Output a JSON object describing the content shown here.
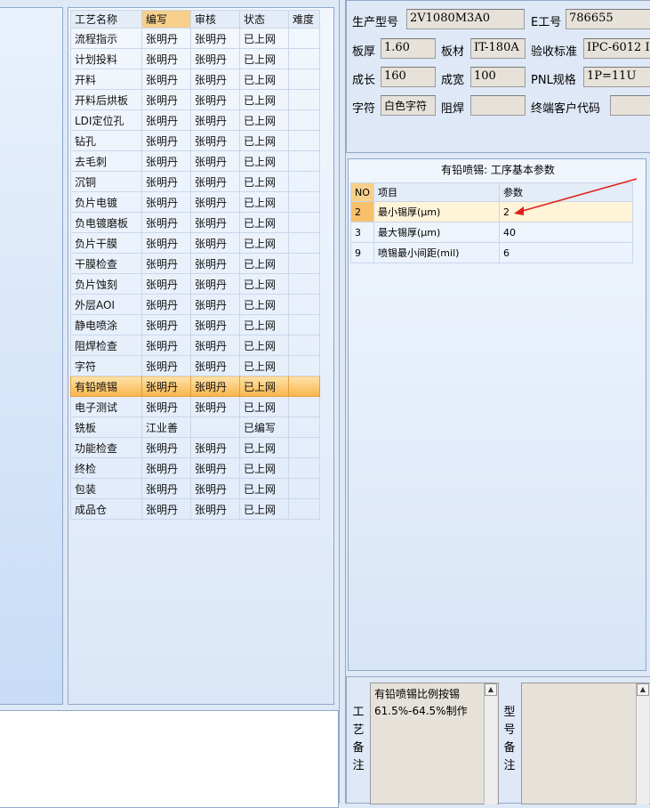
{
  "process_grid": {
    "columns": [
      "工艺名称",
      "编写",
      "审核",
      "状态",
      "难度"
    ],
    "selected_row": "有铅喷锡",
    "rows": [
      {
        "name": "流程指示",
        "author": "张明丹",
        "reviewer": "张明丹",
        "status": "已上网",
        "difficulty": ""
      },
      {
        "name": "计划投料",
        "author": "张明丹",
        "reviewer": "张明丹",
        "status": "已上网",
        "difficulty": ""
      },
      {
        "name": "开料",
        "author": "张明丹",
        "reviewer": "张明丹",
        "status": "已上网",
        "difficulty": ""
      },
      {
        "name": "开料后烘板",
        "author": "张明丹",
        "reviewer": "张明丹",
        "status": "已上网",
        "difficulty": ""
      },
      {
        "name": "LDI定位孔",
        "author": "张明丹",
        "reviewer": "张明丹",
        "status": "已上网",
        "difficulty": ""
      },
      {
        "name": "钻孔",
        "author": "张明丹",
        "reviewer": "张明丹",
        "status": "已上网",
        "difficulty": ""
      },
      {
        "name": "去毛刺",
        "author": "张明丹",
        "reviewer": "张明丹",
        "status": "已上网",
        "difficulty": ""
      },
      {
        "name": "沉铜",
        "author": "张明丹",
        "reviewer": "张明丹",
        "status": "已上网",
        "difficulty": ""
      },
      {
        "name": "负片电镀",
        "author": "张明丹",
        "reviewer": "张明丹",
        "status": "已上网",
        "difficulty": ""
      },
      {
        "name": "负电镀磨板",
        "author": "张明丹",
        "reviewer": "张明丹",
        "status": "已上网",
        "difficulty": ""
      },
      {
        "name": "负片干膜",
        "author": "张明丹",
        "reviewer": "张明丹",
        "status": "已上网",
        "difficulty": ""
      },
      {
        "name": "干膜检查",
        "author": "张明丹",
        "reviewer": "张明丹",
        "status": "已上网",
        "difficulty": ""
      },
      {
        "name": "负片蚀刻",
        "author": "张明丹",
        "reviewer": "张明丹",
        "status": "已上网",
        "difficulty": ""
      },
      {
        "name": "外层AOI",
        "author": "张明丹",
        "reviewer": "张明丹",
        "status": "已上网",
        "difficulty": ""
      },
      {
        "name": "静电喷涂",
        "author": "张明丹",
        "reviewer": "张明丹",
        "status": "已上网",
        "difficulty": ""
      },
      {
        "name": "阻焊检查",
        "author": "张明丹",
        "reviewer": "张明丹",
        "status": "已上网",
        "difficulty": ""
      },
      {
        "name": "字符",
        "author": "张明丹",
        "reviewer": "张明丹",
        "status": "已上网",
        "difficulty": ""
      },
      {
        "name": "有铅喷锡",
        "author": "张明丹",
        "reviewer": "张明丹",
        "status": "已上网",
        "difficulty": ""
      },
      {
        "name": "电子测试",
        "author": "张明丹",
        "reviewer": "张明丹",
        "status": "已上网",
        "difficulty": ""
      },
      {
        "name": "铣板",
        "author": "江业善",
        "reviewer": "",
        "status": "已编写",
        "difficulty": ""
      },
      {
        "name": "功能检查",
        "author": "张明丹",
        "reviewer": "张明丹",
        "status": "已上网",
        "difficulty": ""
      },
      {
        "name": "终检",
        "author": "张明丹",
        "reviewer": "张明丹",
        "status": "已上网",
        "difficulty": ""
      },
      {
        "name": "包装",
        "author": "张明丹",
        "reviewer": "张明丹",
        "status": "已上网",
        "difficulty": ""
      },
      {
        "name": "成品仓",
        "author": "张明丹",
        "reviewer": "张明丹",
        "status": "已上网",
        "difficulty": ""
      }
    ]
  },
  "info": {
    "model_label": "生产型号",
    "model_value": "2V1080M3A0",
    "e_no_label": "E工号",
    "e_no_value": "786655",
    "thickness_label": "板厚",
    "thickness_value": "1.60",
    "material_label": "板材",
    "material_value": "IT-180A",
    "standard_label": "验收标准",
    "standard_value": "IPC-6012 I",
    "length_label": "成长",
    "length_value": "160",
    "width_label": "成宽",
    "width_value": "100",
    "pnl_label": "PNL规格",
    "pnl_value": "1P=11U",
    "char_label": "字符",
    "char_value": "白色字符",
    "mask_label": "阻焊",
    "mask_value": "",
    "customer_label": "终端客户代码",
    "customer_value": ""
  },
  "params": {
    "title": "有铅喷锡: 工序基本参数",
    "columns": [
      "NO",
      "项目",
      "参数"
    ],
    "rows": [
      {
        "no": "2",
        "item": "最小锡厚(μm)",
        "value": "2"
      },
      {
        "no": "3",
        "item": "最大锡厚(μm)",
        "value": "40"
      },
      {
        "no": "9",
        "item": "喷锡最小间距(mil)",
        "value": "6"
      }
    ],
    "annotation_color": "#e0201c"
  },
  "remarks": {
    "process_label": "工艺备注",
    "process_text": "有铅喷锡比例按锡61.5%-64.5%制作",
    "model_label": "型号备注",
    "model_text": ""
  }
}
